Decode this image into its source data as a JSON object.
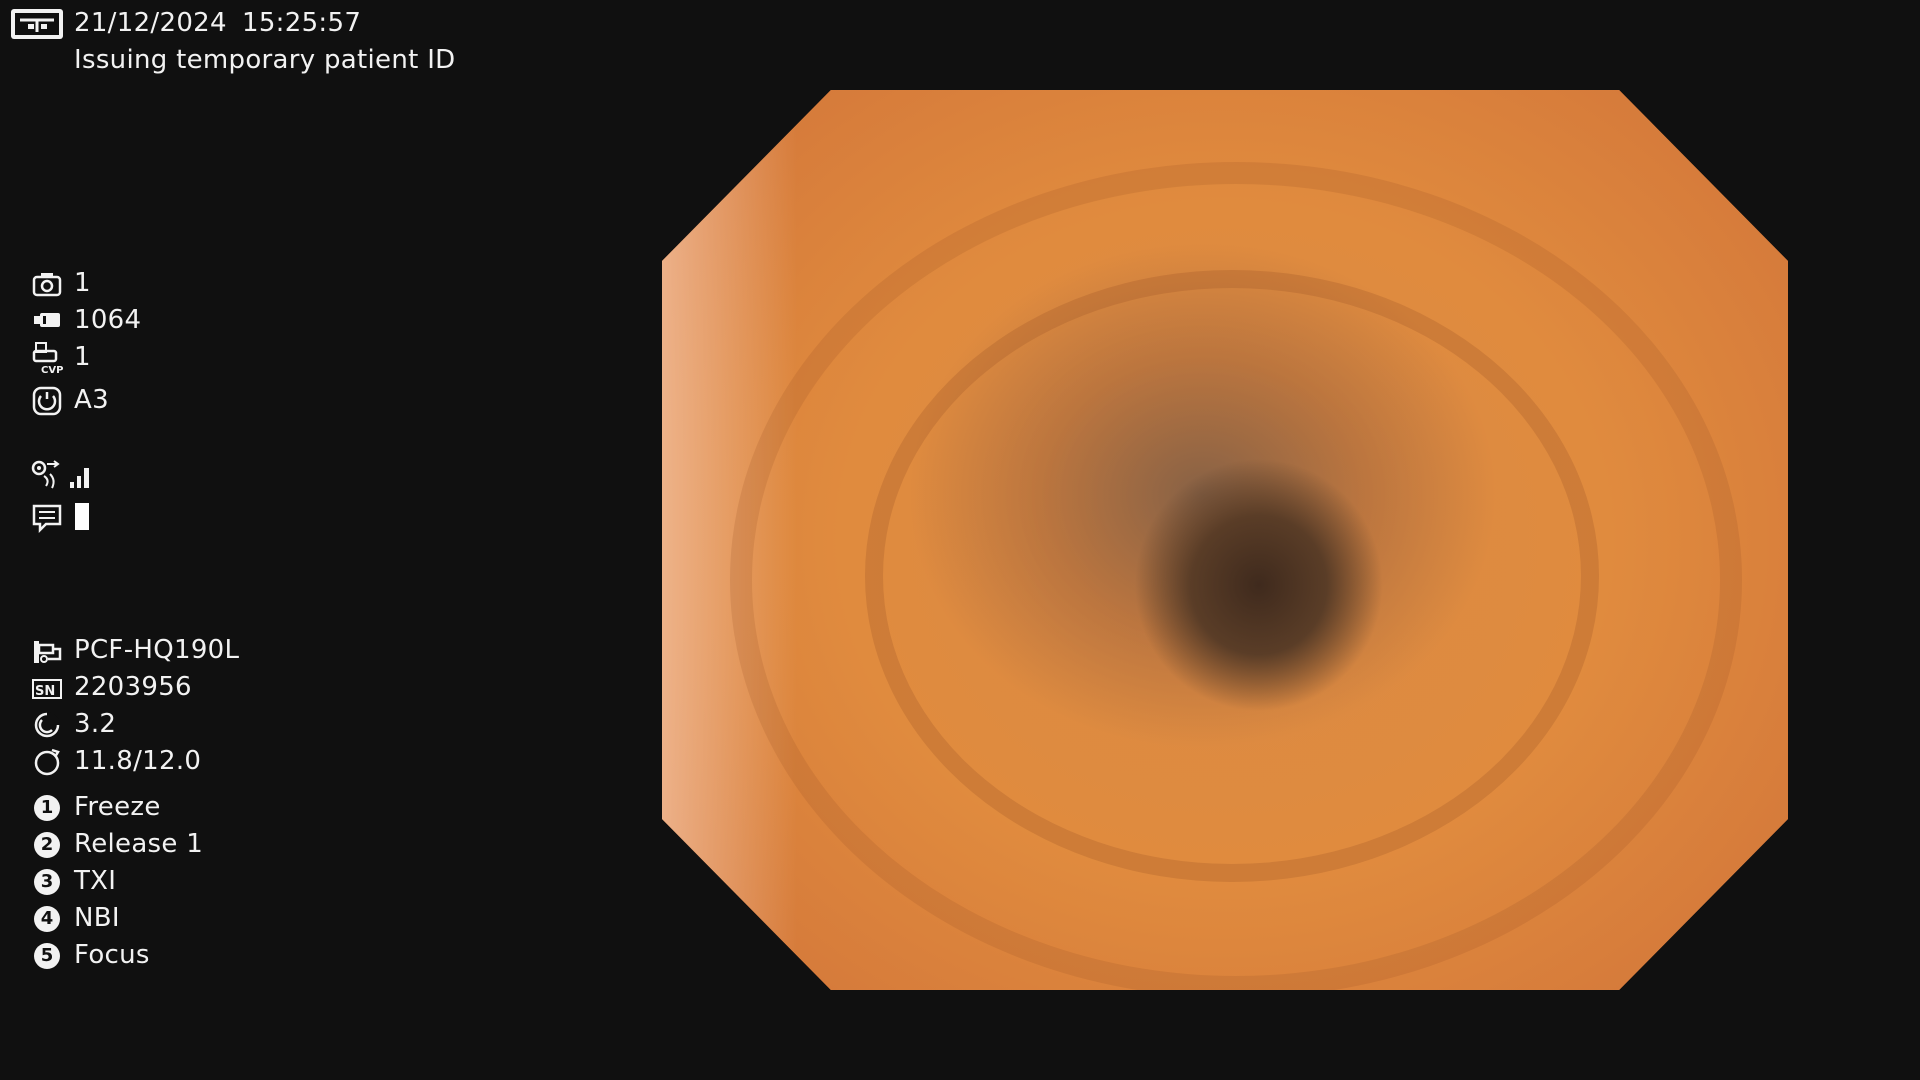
{
  "header": {
    "date": "21/12/2024",
    "time": "15:25:57",
    "patient_status": "Issuing temporary patient ID"
  },
  "counters": {
    "capture_count": "1",
    "media_remaining": "1064",
    "cvp_print_count": "1",
    "image_enhancement": "A3"
  },
  "scope": {
    "model": "PCF-HQ190L",
    "serial_number": "2203956",
    "bending_value": "3.2",
    "diameter_value": "11.8/12.0"
  },
  "switches": [
    {
      "number": "1",
      "label": "Freeze"
    },
    {
      "number": "2",
      "label": "Release 1"
    },
    {
      "number": "3",
      "label": "TXI"
    },
    {
      "number": "4",
      "label": "NBI"
    },
    {
      "number": "5",
      "label": "Focus"
    }
  ],
  "icons": {
    "header": "monitor-icon",
    "capture": "camera-icon",
    "media": "media-card-icon",
    "cvp": "printer-cvp-icon",
    "enhancement": "enhancement-icon",
    "signal": "airflow-signal-icon",
    "comment": "comment-icon",
    "scope": "scope-icon",
    "serial": "serial-number-icon",
    "bending": "bending-icon",
    "diameter": "diameter-icon"
  },
  "colors": {
    "background": "#101010",
    "text": "#f2f2f2",
    "tissue": "#e08b3e"
  }
}
